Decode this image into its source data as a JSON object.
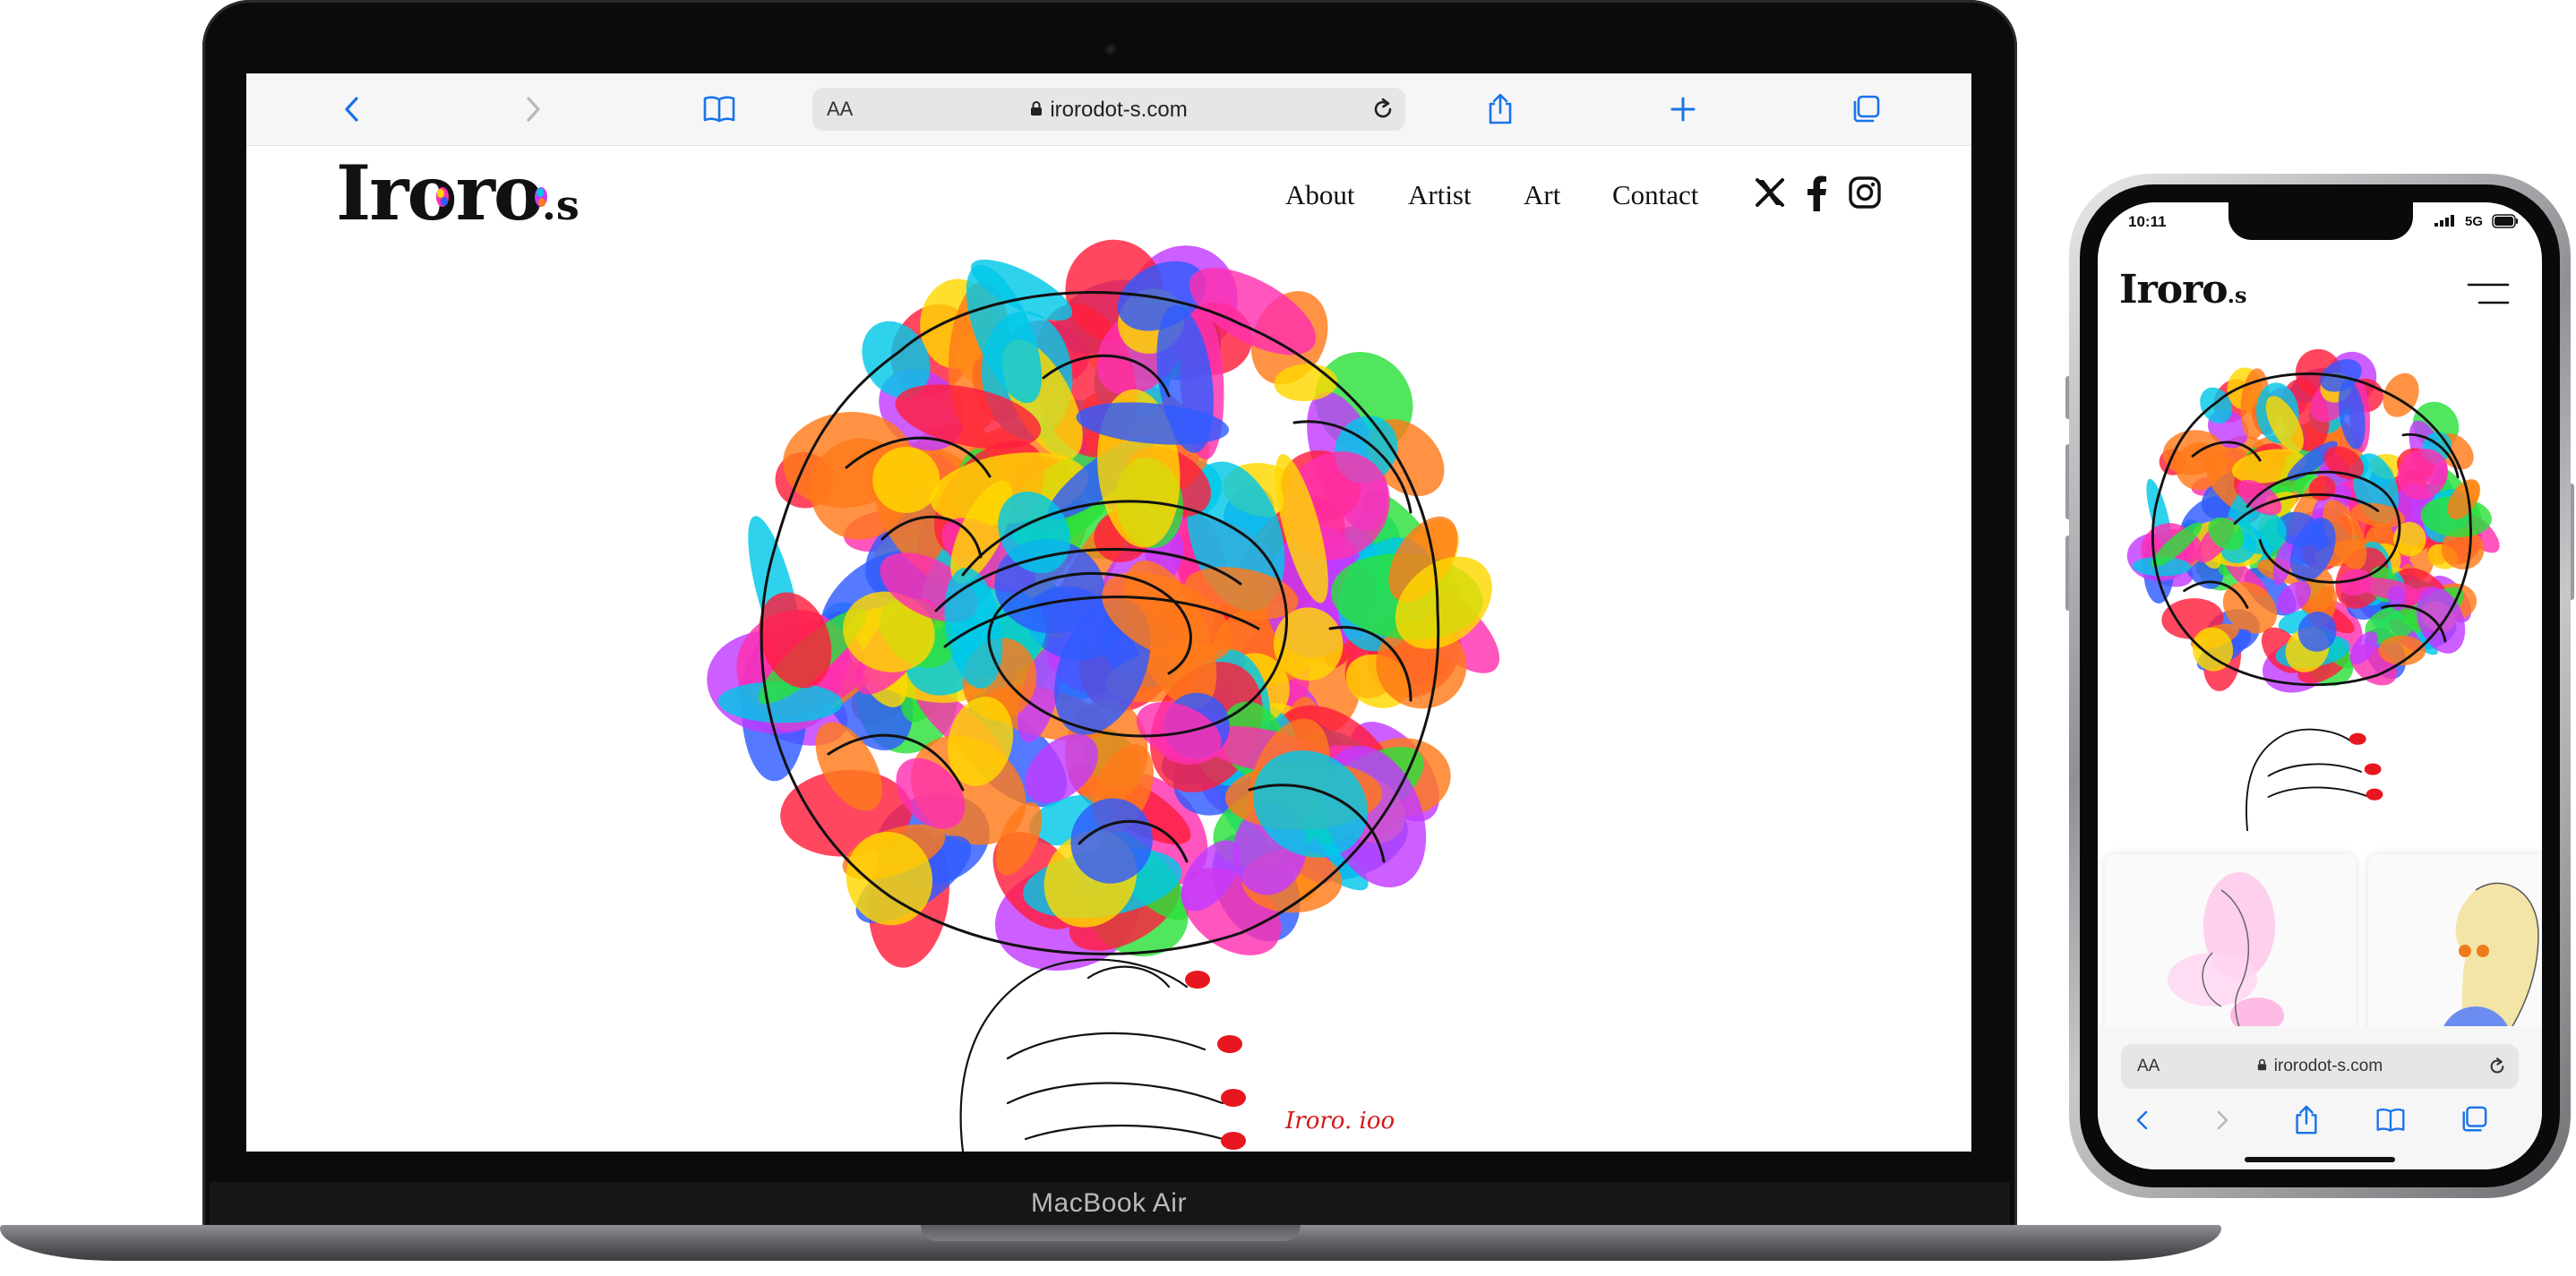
{
  "laptop": {
    "model_label": "MacBook Air",
    "browser": {
      "aa_label": "AA",
      "url": "irorodot-s.com"
    },
    "site": {
      "logo_main": "Iroro",
      "logo_suffix": ".s",
      "nav": [
        "About",
        "Artist",
        "Art",
        "Contact"
      ],
      "social_icons": [
        "x-icon",
        "facebook-icon",
        "instagram-icon"
      ]
    },
    "artwork_signature": "Iroro. ioo"
  },
  "phone": {
    "status": {
      "time": "10:11",
      "network": "5G"
    },
    "site": {
      "logo_main": "Iroro",
      "logo_suffix": ".s"
    },
    "browser": {
      "aa_label": "AA",
      "url": "irorodot-s.com"
    }
  },
  "colors": {
    "safari_blue": "#1a73e8",
    "brush_colors": [
      "#ff1f3d",
      "#ff7a1a",
      "#ffd800",
      "#2be03a",
      "#00c8e8",
      "#2f5bff",
      "#c23bff",
      "#ff2fb0"
    ]
  }
}
